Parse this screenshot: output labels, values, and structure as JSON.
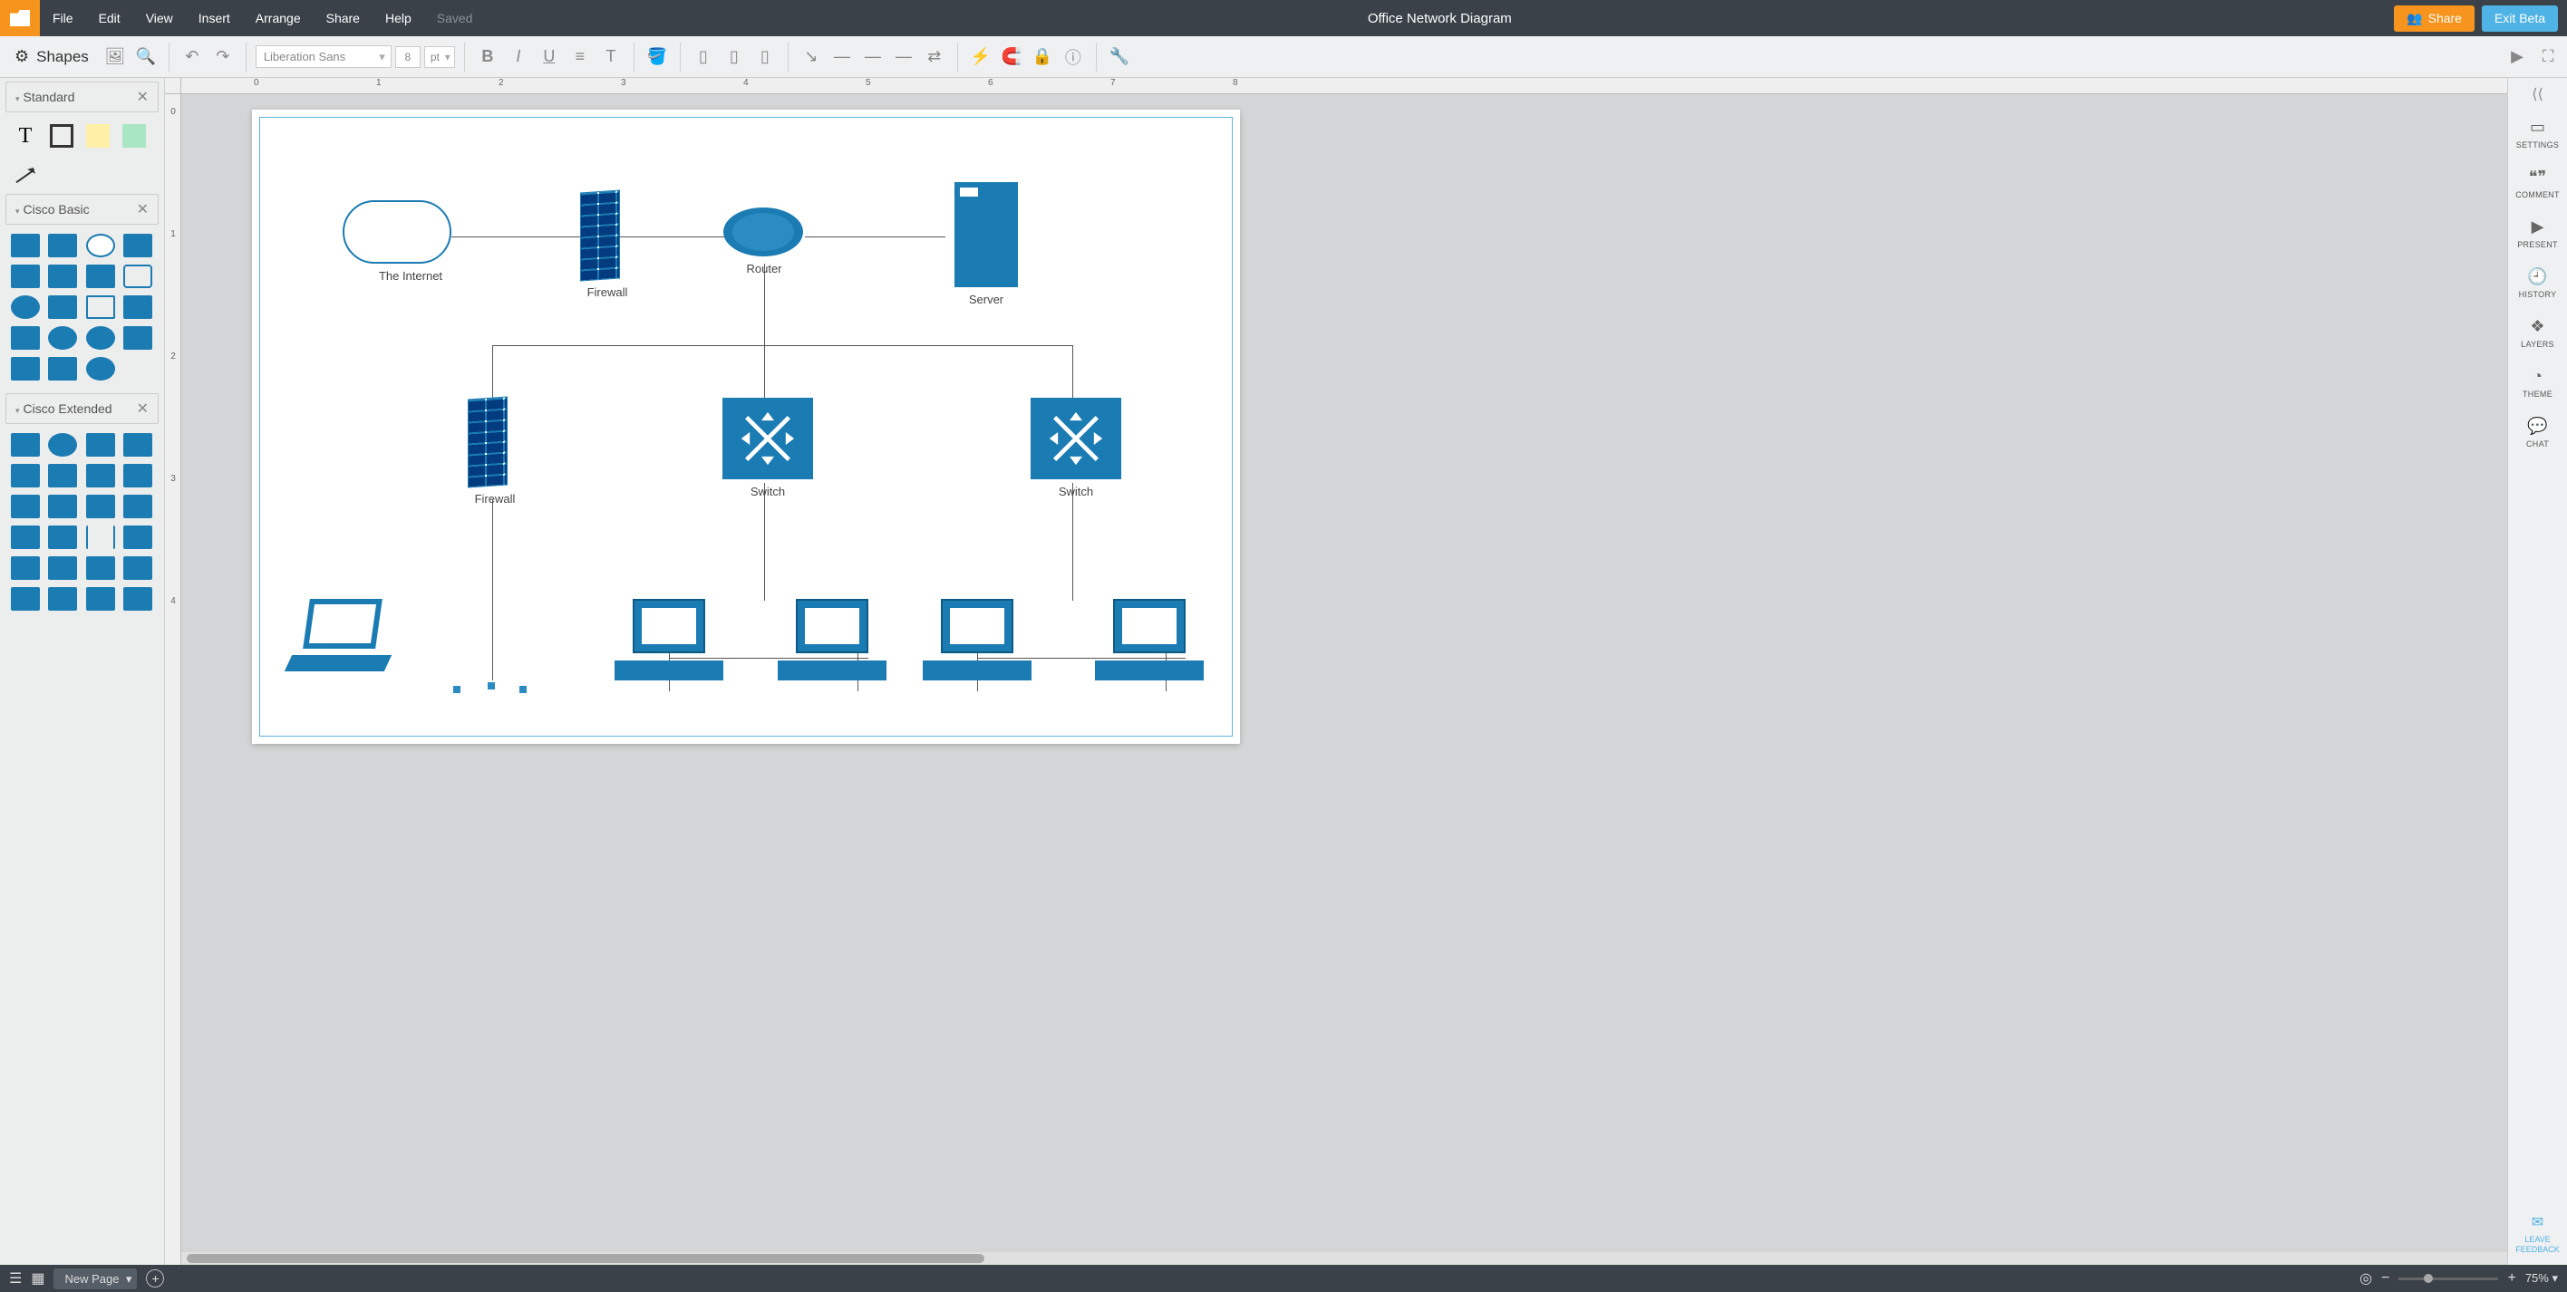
{
  "menu": {
    "items": [
      "File",
      "Edit",
      "View",
      "Insert",
      "Arrange",
      "Share",
      "Help"
    ],
    "saved": "Saved",
    "title": "Office Network Diagram",
    "share": "Share",
    "exit": "Exit Beta"
  },
  "toolbar": {
    "shapes": "Shapes",
    "font": "Liberation Sans",
    "size": "8",
    "unit": "pt"
  },
  "shapeCats": {
    "standard": "Standard",
    "ciscoBasic": "Cisco Basic",
    "ciscoExt": "Cisco Extended"
  },
  "rightRail": {
    "settings": "SETTINGS",
    "comment": "COMMENT",
    "present": "PRESENT",
    "history": "HISTORY",
    "layers": "LAYERS",
    "theme": "THEME",
    "chat": "CHAT",
    "leave": "LEAVE",
    "feedback": "FEEDBACK"
  },
  "bottom": {
    "page": "New Page",
    "zoom": "75%"
  },
  "diagram": {
    "nodes": {
      "internet": {
        "label": "The Internet"
      },
      "fw1": {
        "label": "Firewall"
      },
      "router": {
        "label": "Router"
      },
      "server": {
        "label": "Server"
      },
      "fw2": {
        "label": "Firewall"
      },
      "sw1": {
        "label": "Switch"
      },
      "sw2": {
        "label": "Switch"
      }
    }
  },
  "rulerH": [
    "0",
    "1",
    "2",
    "3",
    "4",
    "5",
    "6",
    "7",
    "8"
  ],
  "rulerV": [
    "0",
    "1",
    "2",
    "3",
    "4"
  ]
}
